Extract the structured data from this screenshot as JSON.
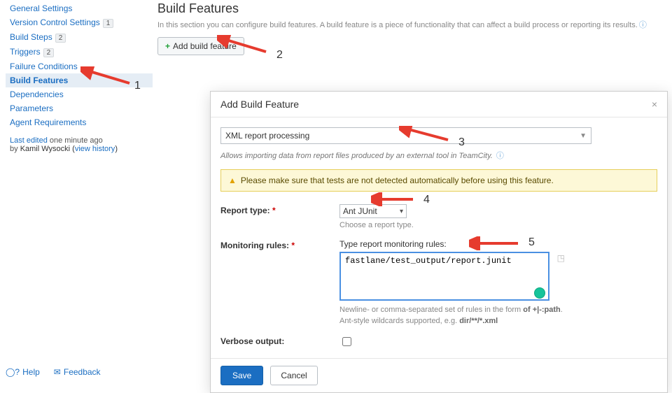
{
  "sidebar": {
    "items": [
      {
        "label": "General Settings",
        "badge": ""
      },
      {
        "label": "Version Control Settings",
        "badge": "1"
      },
      {
        "label": "Build Steps",
        "badge": "2"
      },
      {
        "label": "Triggers",
        "badge": "2"
      },
      {
        "label": "Failure Conditions",
        "badge": ""
      },
      {
        "label": "Build Features",
        "badge": ""
      },
      {
        "label": "Dependencies",
        "badge": ""
      },
      {
        "label": "Parameters",
        "badge": ""
      },
      {
        "label": "Agent Requirements",
        "badge": ""
      }
    ],
    "last_edited_prefix": "Last edited",
    "last_edited_time": "one minute ago",
    "by_label": "by",
    "author": "Kamil Wysocki",
    "view_history": "view history"
  },
  "page": {
    "title": "Build Features",
    "description": "In this section you can configure build features. A build feature is a piece of functionality that can affect a build process or reporting its results.",
    "add_button": "Add build feature"
  },
  "dialog": {
    "title": "Add Build Feature",
    "feature_type": "XML report processing",
    "feature_desc": "Allows importing data from report files produced by an external tool in TeamCity.",
    "warning": "Please make sure that tests are not detected automatically before using this feature.",
    "report_type_label": "Report type:",
    "report_type_value": "Ant JUnit",
    "report_type_hint": "Choose a report type.",
    "monitoring_label": "Monitoring rules:",
    "monitoring_field_label": "Type report monitoring rules:",
    "monitoring_value": "fastlane/test_output/report.junit",
    "monitoring_hint1_a": "Newline- or comma-separated set of rules in the form ",
    "monitoring_hint1_b": "of +|-:path",
    "monitoring_hint1_c": ".",
    "monitoring_hint2_a": "Ant-style wildcards supported, e.g. ",
    "monitoring_hint2_b": "dir/**/*.xml",
    "verbose_label": "Verbose output:",
    "save": "Save",
    "cancel": "Cancel"
  },
  "footer": {
    "help": "Help",
    "feedback": "Feedback"
  },
  "annotations": {
    "n1": "1",
    "n2": "2",
    "n3": "3",
    "n4": "4",
    "n5": "5"
  }
}
